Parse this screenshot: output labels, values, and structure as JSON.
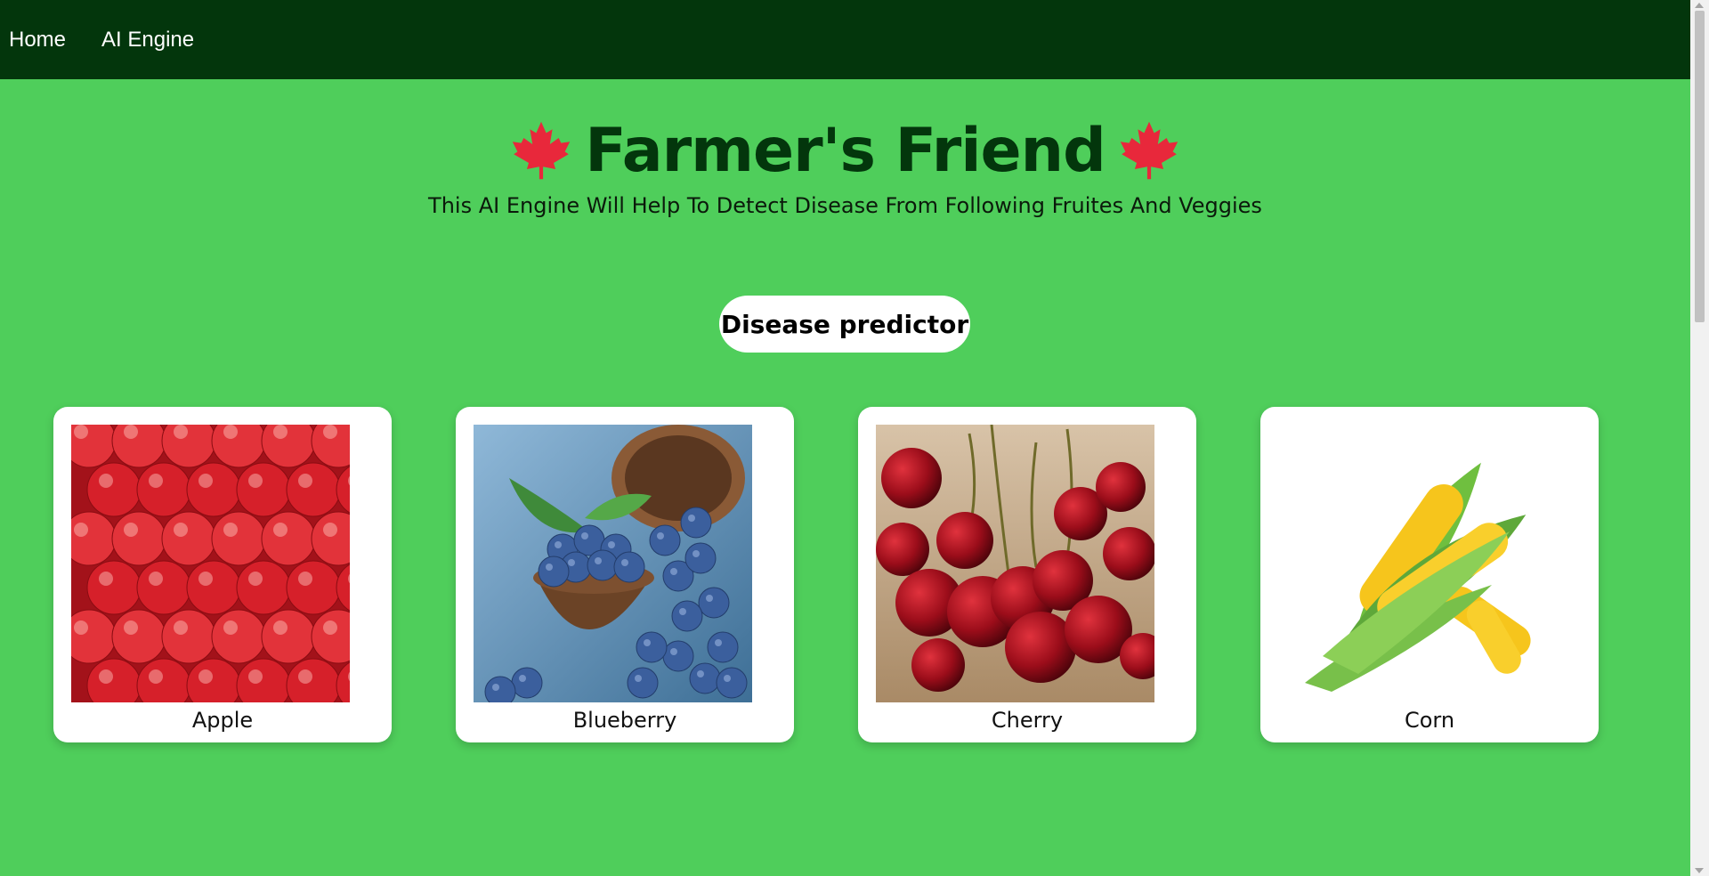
{
  "nav": {
    "items": [
      {
        "label": "Home"
      },
      {
        "label": "AI Engine"
      }
    ]
  },
  "header": {
    "title": "Farmer's Friend",
    "subtitle": "This AI Engine Will Help To Detect Disease From Following Fruites And Veggies"
  },
  "predictor_button": {
    "label": "Disease predictor"
  },
  "cards": [
    {
      "label": "Apple"
    },
    {
      "label": "Blueberry"
    },
    {
      "label": "Cherry"
    },
    {
      "label": "Corn"
    }
  ],
  "colors": {
    "background": "#4fce5b",
    "navbar": "#03360c",
    "title": "#03360c",
    "leaf": "#e8283b"
  }
}
